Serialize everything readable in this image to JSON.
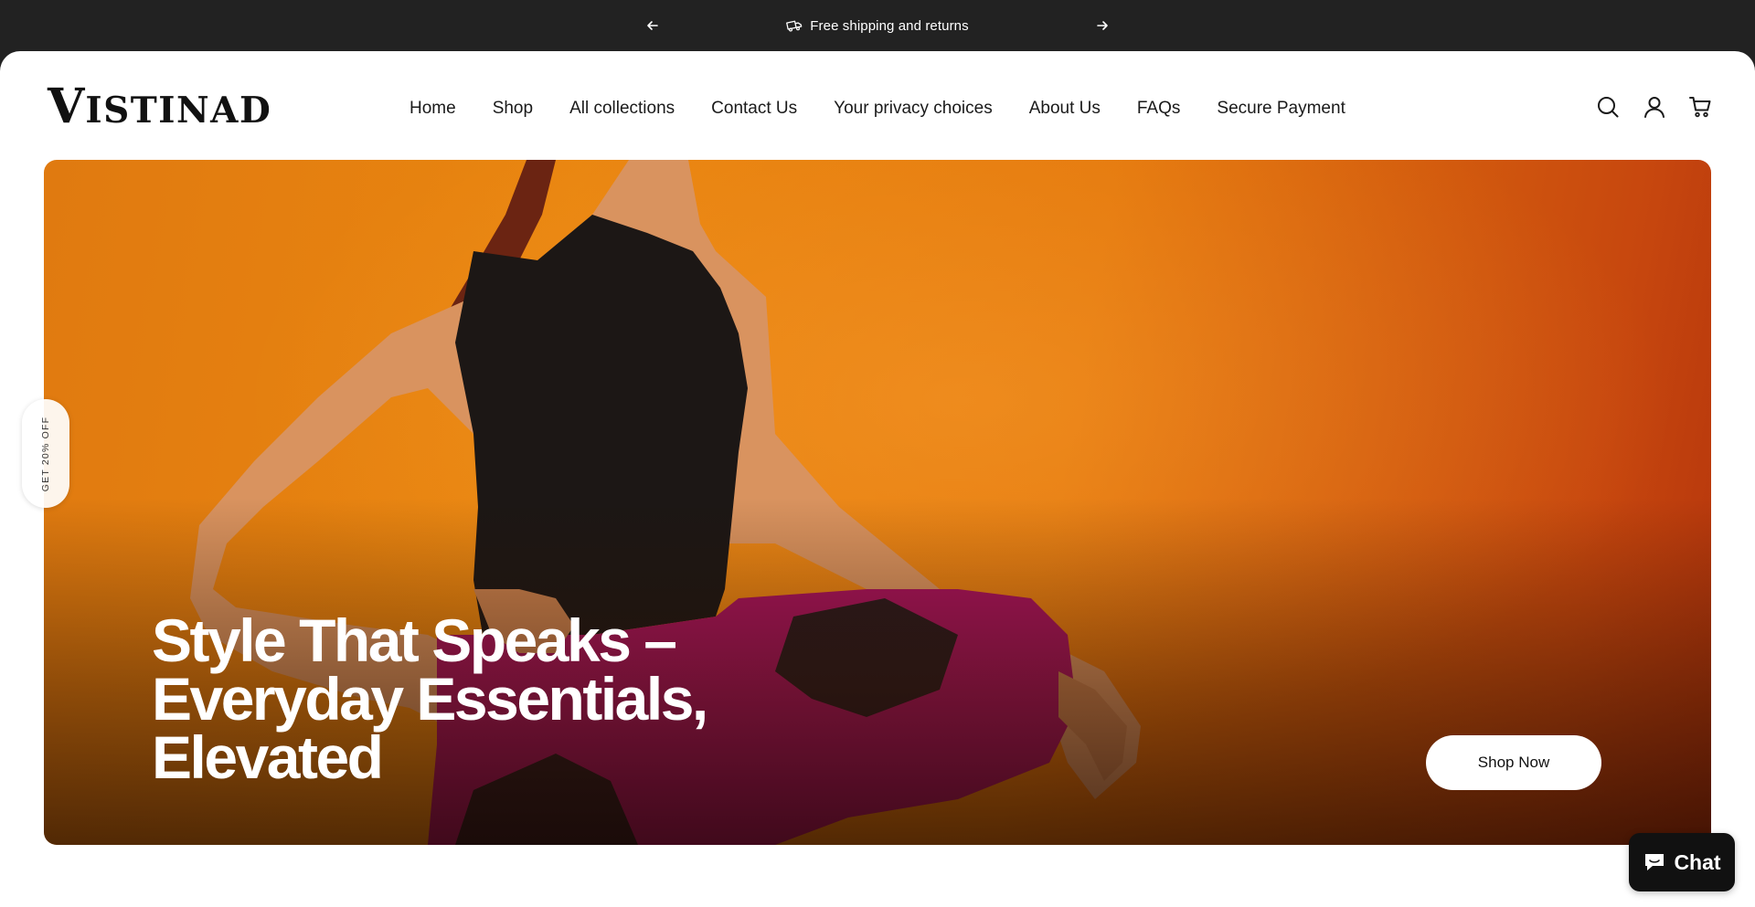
{
  "announcement": {
    "message": "Free shipping and returns",
    "icon": "truck-icon"
  },
  "brand": {
    "logo_initial": "V",
    "logo_rest": "ISTINAD"
  },
  "nav": {
    "items": [
      {
        "label": "Home"
      },
      {
        "label": "Shop"
      },
      {
        "label": "All collections"
      },
      {
        "label": "Contact Us"
      },
      {
        "label": "Your privacy choices"
      },
      {
        "label": "About Us"
      },
      {
        "label": "FAQs"
      },
      {
        "label": "Secure Payment"
      }
    ]
  },
  "header_icons": [
    "search-icon",
    "account-icon",
    "cart-icon"
  ],
  "hero": {
    "title_line1": "Style That Speaks –",
    "title_line2": "Everyday Essentials,",
    "title_line3": "Elevated",
    "cta_label": "Shop Now"
  },
  "discount_tab": {
    "label": "GET 20% OFF"
  },
  "chat": {
    "label": "Chat"
  },
  "colors": {
    "announcement_bg": "#222222",
    "hero_orange": "#e9850f",
    "top_magenta": "#a8135c",
    "tank_black": "#1c1715"
  }
}
